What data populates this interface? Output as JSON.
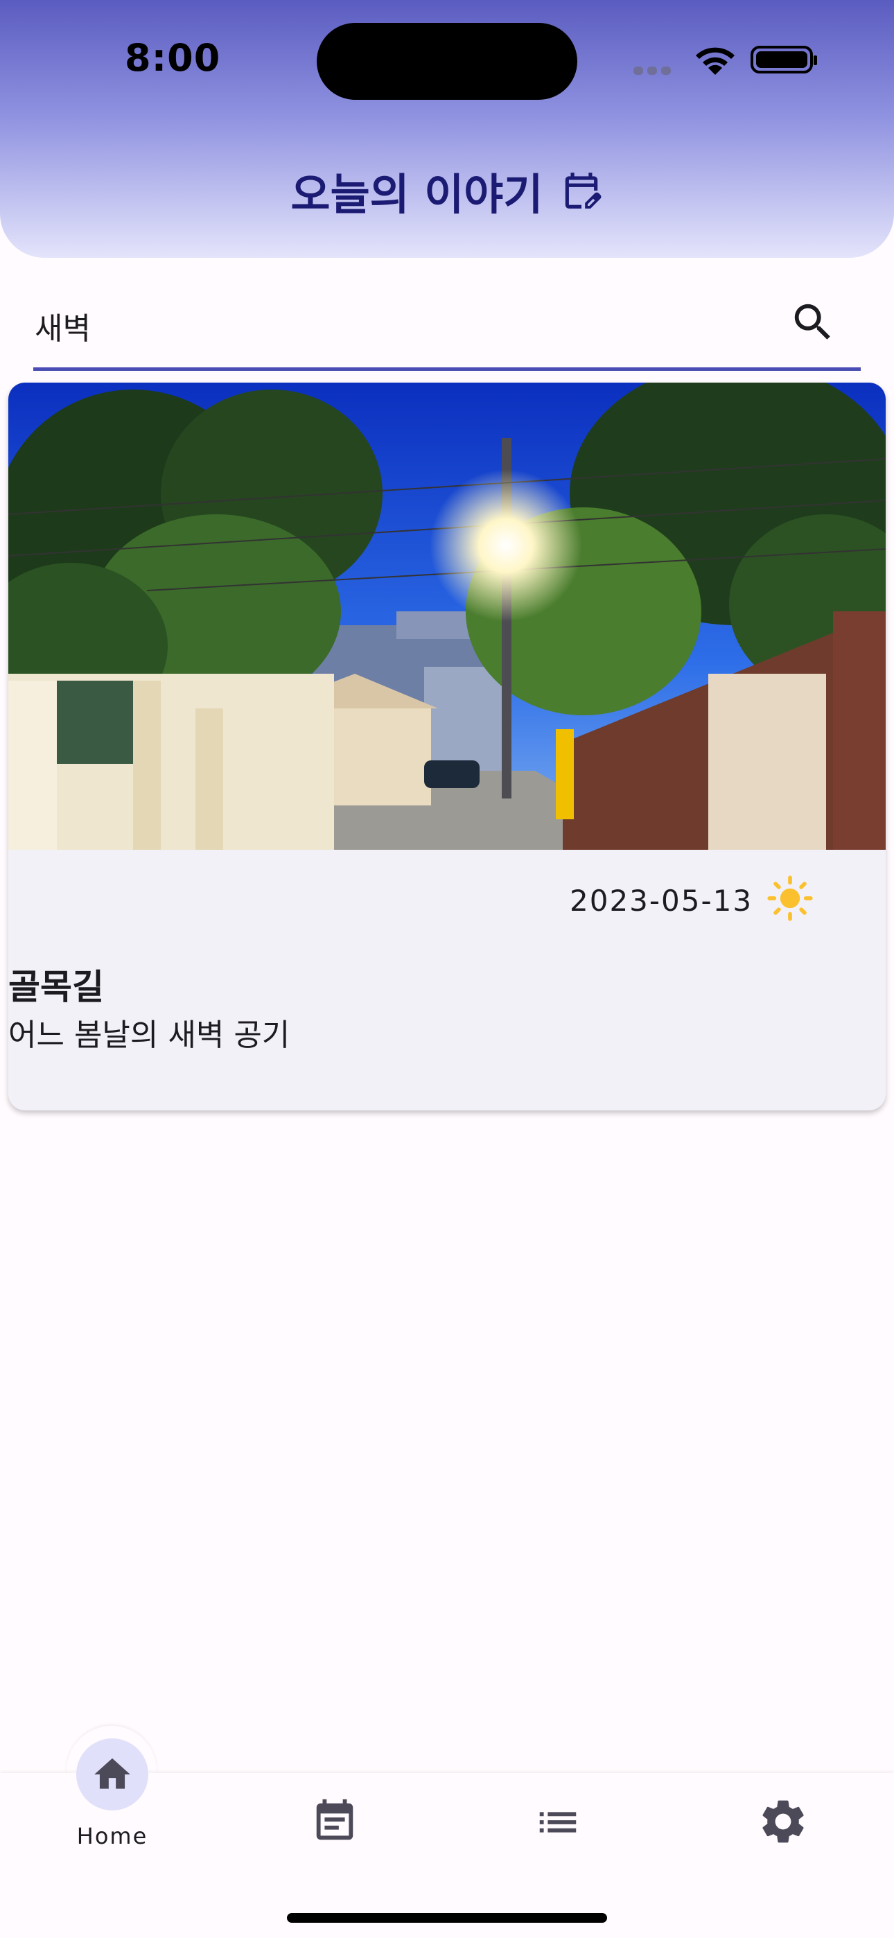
{
  "status_bar": {
    "time": "8:00"
  },
  "header": {
    "title": "오늘의 이야기",
    "title_icon": "edit-calendar-icon"
  },
  "search": {
    "value": "새벽",
    "icon": "search-icon"
  },
  "entries": [
    {
      "date": "2023-05-13",
      "weather_icon": "sun-icon",
      "title": "골목길",
      "subtitle": "어느 봄날의 새벽 공기"
    }
  ],
  "bottom_nav": {
    "items": [
      {
        "label": "Home",
        "icon": "home-icon",
        "active": true
      },
      {
        "label": "",
        "icon": "calendar-icon",
        "active": false
      },
      {
        "label": "",
        "icon": "list-icon",
        "active": false
      },
      {
        "label": "",
        "icon": "gear-icon",
        "active": false
      }
    ]
  },
  "colors": {
    "accent": "#4a4db3",
    "title": "#1b1b73",
    "nav_active_bg": "#e1e0fa",
    "sun": "#fbc02d"
  }
}
